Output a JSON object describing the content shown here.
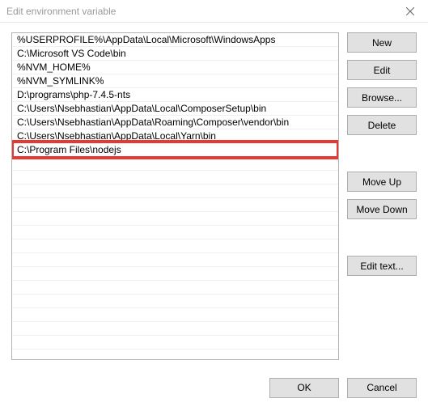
{
  "window": {
    "title": "Edit environment variable"
  },
  "list": {
    "items": [
      "%USERPROFILE%\\AppData\\Local\\Microsoft\\WindowsApps",
      "C:\\Microsoft VS Code\\bin",
      "%NVM_HOME%",
      "%NVM_SYMLINK%",
      "D:\\programs\\php-7.4.5-nts",
      "C:\\Users\\Nsebhastian\\AppData\\Local\\ComposerSetup\\bin",
      "C:\\Users\\Nsebhastian\\AppData\\Roaming\\Composer\\vendor\\bin",
      "C:\\Users\\Nsebhastian\\AppData\\Local\\Yarn\\bin",
      "C:\\Program Files\\nodejs"
    ],
    "highlighted_index": 8,
    "blank_rows": 14
  },
  "buttons": {
    "new": "New",
    "edit": "Edit",
    "browse": "Browse...",
    "delete": "Delete",
    "moveup": "Move Up",
    "movedown": "Move Down",
    "edittext": "Edit text...",
    "ok": "OK",
    "cancel": "Cancel"
  }
}
